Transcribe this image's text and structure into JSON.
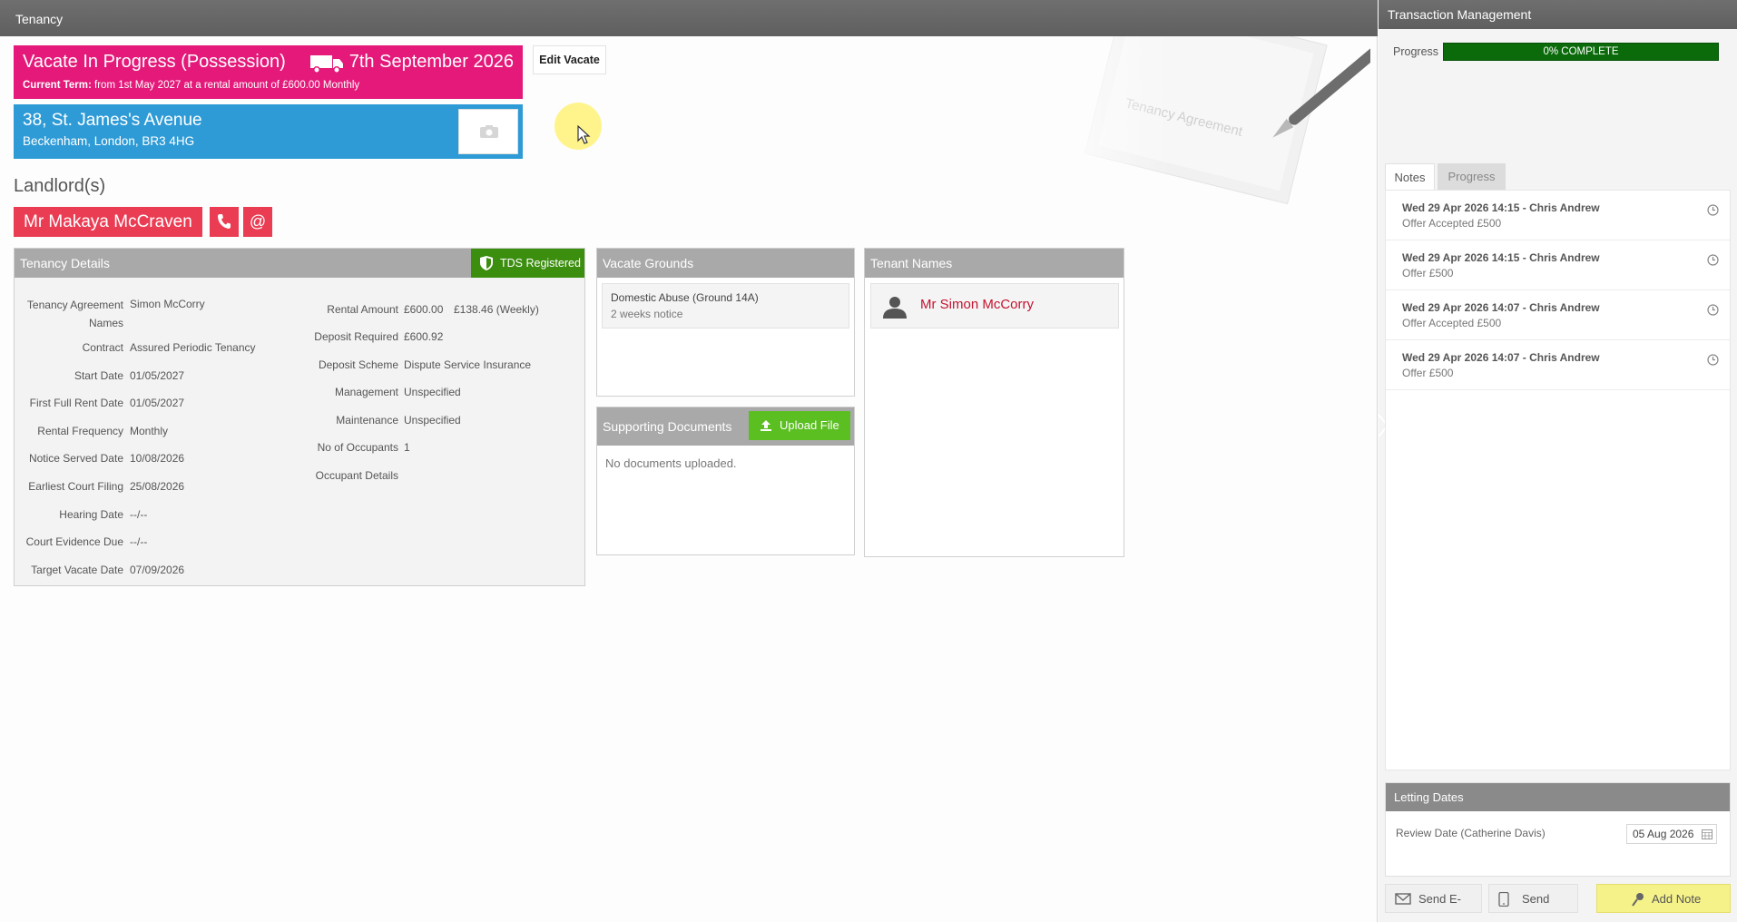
{
  "main_window": {
    "title": "Tenancy"
  },
  "status": {
    "title": "Vacate In Progress (Possession)",
    "date": "7th September 2026",
    "term_label": "Current Term:",
    "term_text": "from 1st May 2027 at a rental amount of £600.00 Monthly",
    "color": "#e4197a"
  },
  "edit_vacate_label": "Edit Vacate",
  "address": {
    "line1": "38, St. James's Avenue",
    "line2": "Beckenham, London, BR3 4HG",
    "color": "#2e9bd6"
  },
  "landlords": {
    "heading": "Landlord(s)",
    "name": "Mr Makaya McCraven",
    "email_symbol": "@",
    "color": "#ea3c53"
  },
  "tenancy_details": {
    "title": "Tenancy Details",
    "badge": "TDS Registered",
    "left_fields": [
      {
        "label": "Tenancy Agreement Names",
        "value": "Simon McCorry"
      },
      {
        "label": "Contract",
        "value": "Assured Periodic Tenancy"
      },
      {
        "label": "Start Date",
        "value": "01/05/2027"
      },
      {
        "label": "First Full Rent Date",
        "value": "01/05/2027"
      },
      {
        "label": "Rental Frequency",
        "value": "Monthly"
      },
      {
        "label": "Notice Served Date",
        "value": "10/08/2026"
      },
      {
        "label": "Earliest Court Filing",
        "value": "25/08/2026"
      },
      {
        "label": "Hearing Date",
        "value": "--/--"
      },
      {
        "label": "Court Evidence Due",
        "value": "--/--"
      },
      {
        "label": "Target Vacate Date",
        "value": "07/09/2026"
      }
    ],
    "right_fields": [
      {
        "label": "Rental Amount",
        "value": "£600.00",
        "extra": "£138.46 (Weekly)"
      },
      {
        "label": "Deposit Required",
        "value": "£600.92"
      },
      {
        "label": "Deposit Scheme",
        "value": "Dispute Service Insurance"
      },
      {
        "label": "Management",
        "value": "Unspecified"
      },
      {
        "label": "Maintenance",
        "value": "Unspecified"
      },
      {
        "label": "No of Occupants",
        "value": "1"
      },
      {
        "label": "Occupant Details",
        "value": ""
      }
    ]
  },
  "vacate_grounds": {
    "title": "Vacate Grounds",
    "items": [
      {
        "ground": "Domestic Abuse (Ground 14A)",
        "notice": "2 weeks notice"
      }
    ]
  },
  "supporting_documents": {
    "title": "Supporting Documents",
    "upload_label": "Upload File",
    "empty_text": "No documents uploaded."
  },
  "tenant_names": {
    "title": "Tenant Names",
    "items": [
      "Mr Simon McCorry"
    ]
  },
  "side_panel": {
    "title": "Transaction Management",
    "progress_label": "Progress",
    "progress_text": "0% COMPLETE",
    "progress_value": 0,
    "tabs": [
      "Notes",
      "Progress"
    ],
    "active_tab": "Notes",
    "notes": [
      {
        "header": "Wed 29 Apr 2026 14:15 - Chris Andrew",
        "body": "Offer Accepted £500"
      },
      {
        "header": "Wed 29 Apr 2026 14:15 - Chris Andrew",
        "body": "Offer £500"
      },
      {
        "header": "Wed 29 Apr 2026 14:07 - Chris Andrew",
        "body": "Offer Accepted £500"
      },
      {
        "header": "Wed 29 Apr 2026 14:07 - Chris Andrew",
        "body": "Offer £500"
      }
    ],
    "letting_dates": {
      "title": "Letting Dates",
      "review_label": "Review Date (Catherine Davis)",
      "review_date": "05 Aug 2026"
    },
    "buttons": {
      "send_email": "Send E-Mail",
      "send_sms": "Send SMS",
      "add_note": "Add Note"
    }
  }
}
